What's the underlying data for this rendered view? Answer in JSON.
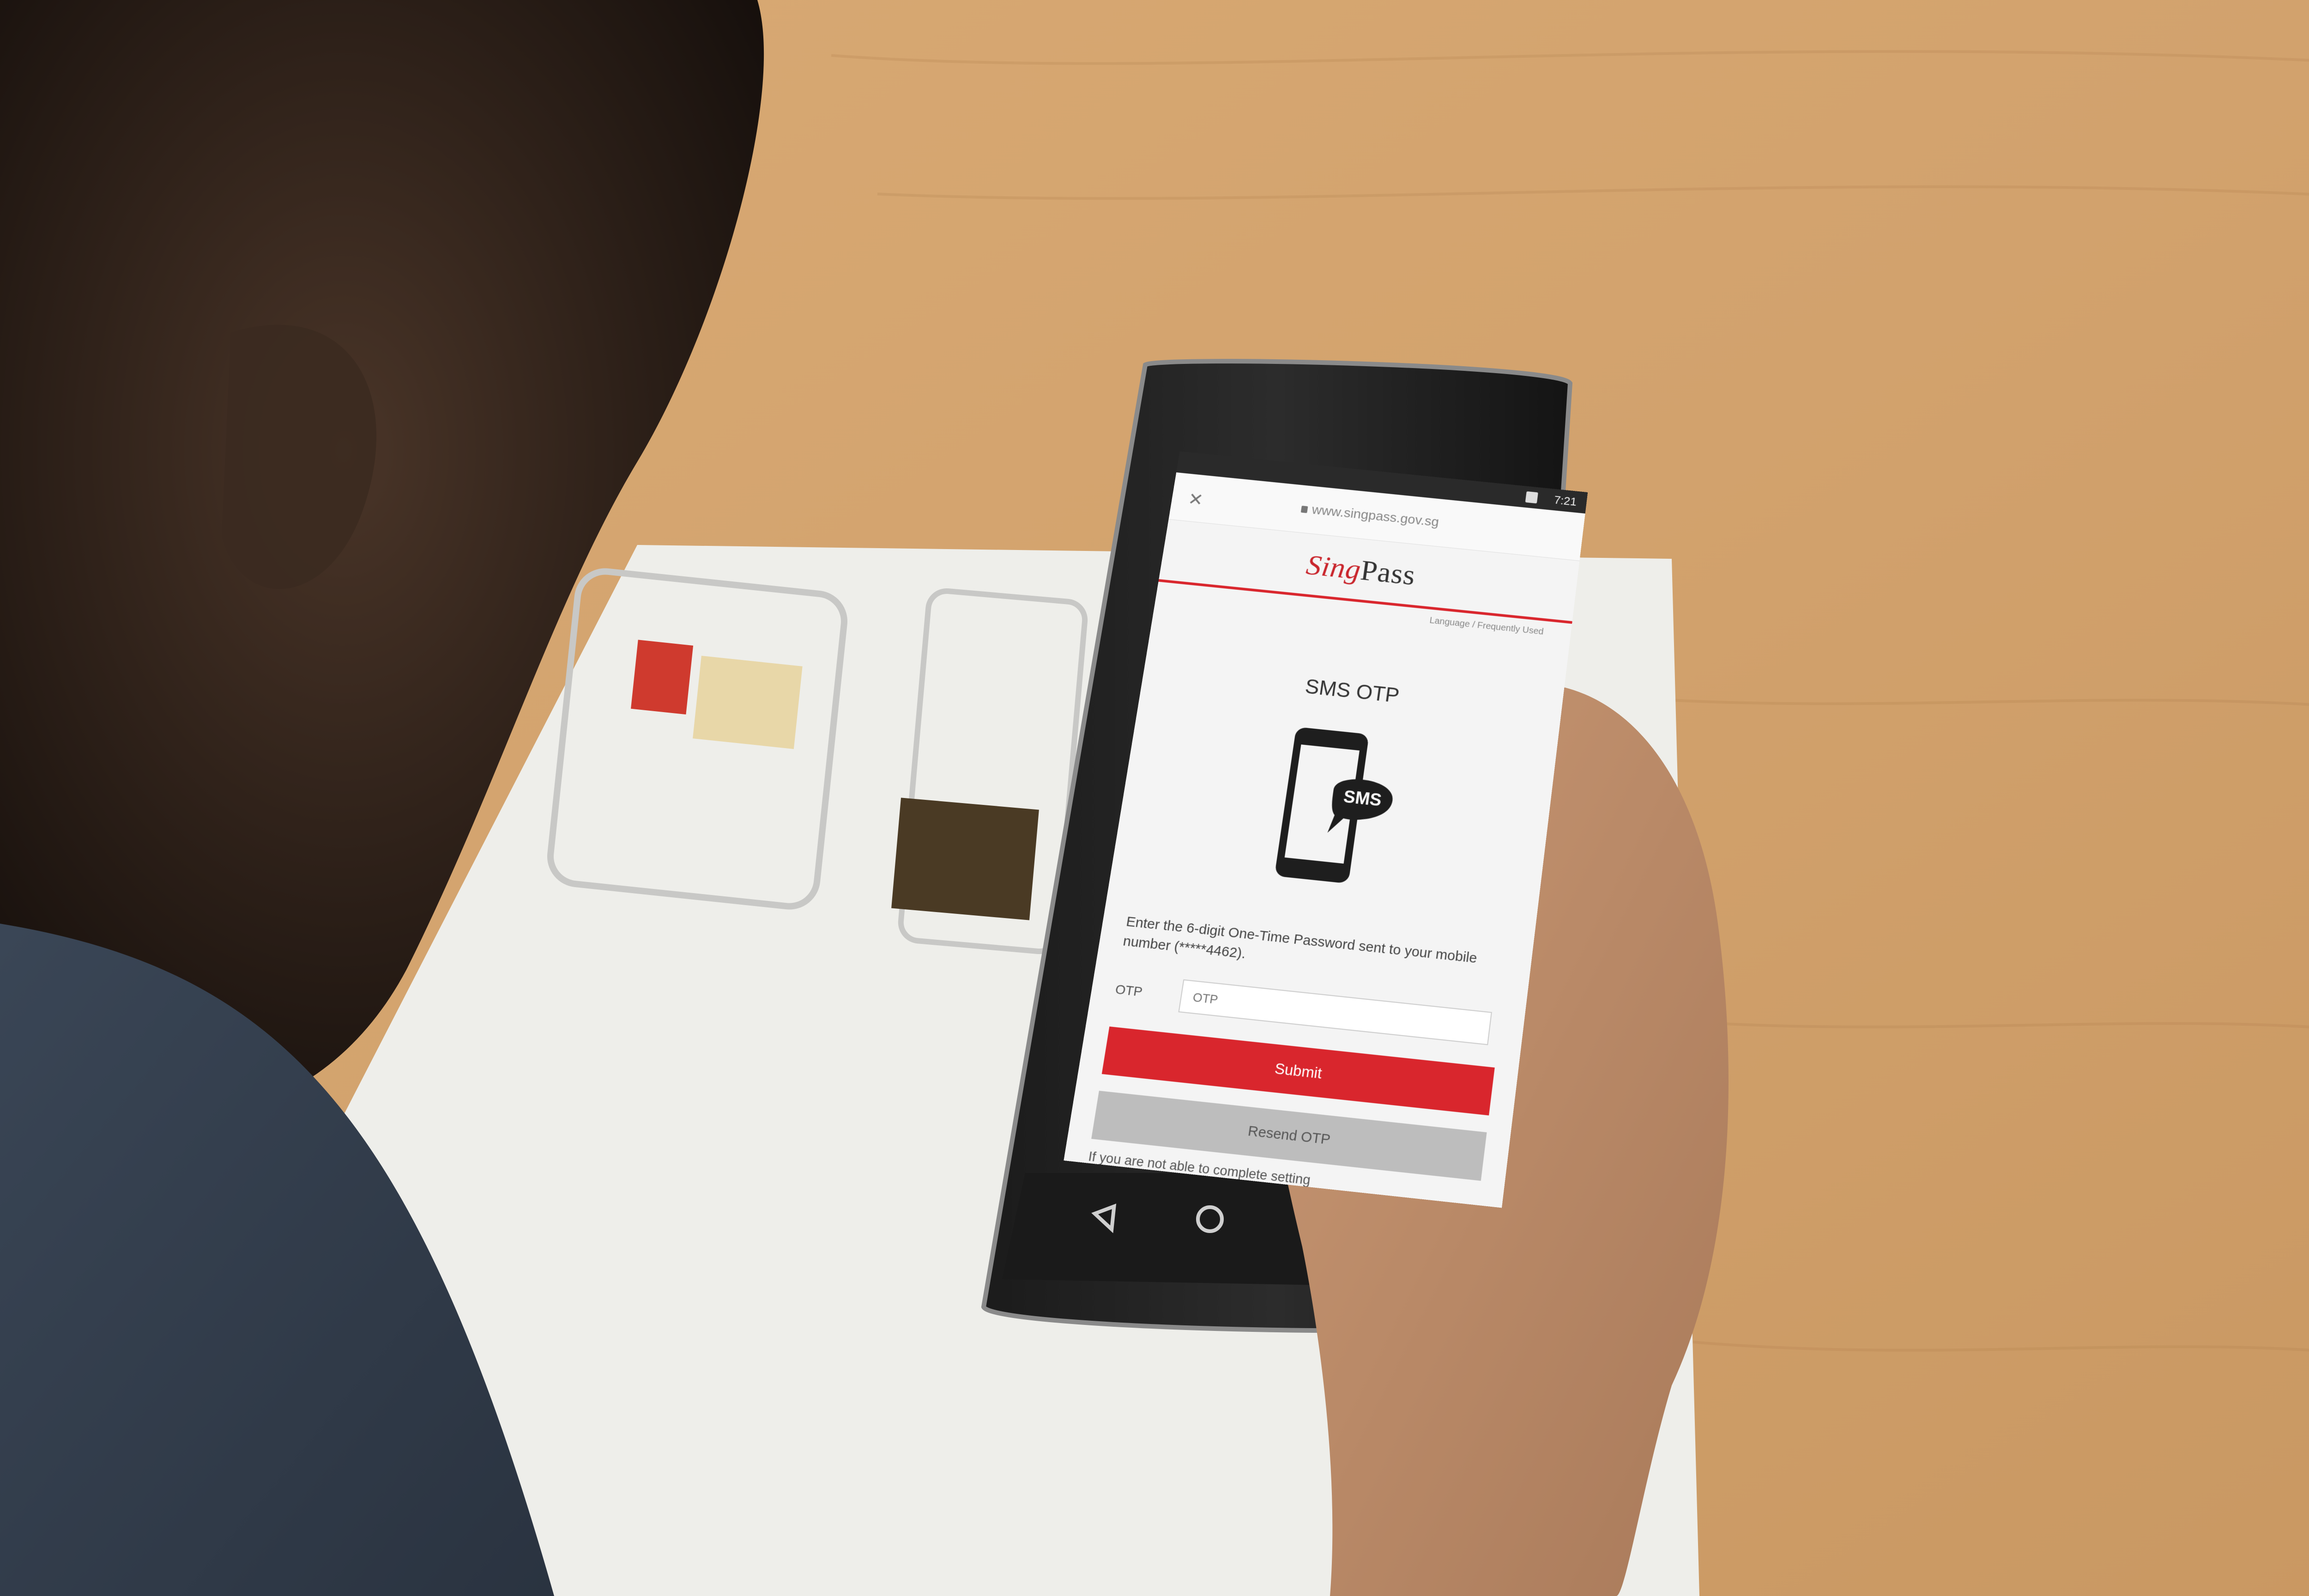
{
  "scene": {
    "description_colors": {
      "table": "#c89a66",
      "brochure": "#eeeeea",
      "accent_red": "#d9262d"
    }
  },
  "phone": {
    "status_bar": {
      "time": "7:21"
    },
    "browser": {
      "url": "www.singpass.gov.sg",
      "close_icon": "close-icon"
    },
    "header": {
      "logo_sing": "Sing",
      "logo_pass": "Pass",
      "lang_links": "Language / Frequently Used"
    },
    "page": {
      "title": "SMS OTP",
      "illustration_label": "SMS",
      "instruction": "Enter the 6-digit One-Time Password sent to your mobile number (*****4462).",
      "otp_label": "OTP",
      "otp_placeholder": "OTP",
      "submit_label": "Submit",
      "resend_label": "Resend OTP",
      "help_text": "If you are not able to complete setting"
    },
    "nav_bar": {
      "back_icon": "back-triangle-icon",
      "home_icon": "home-circle-icon"
    }
  }
}
